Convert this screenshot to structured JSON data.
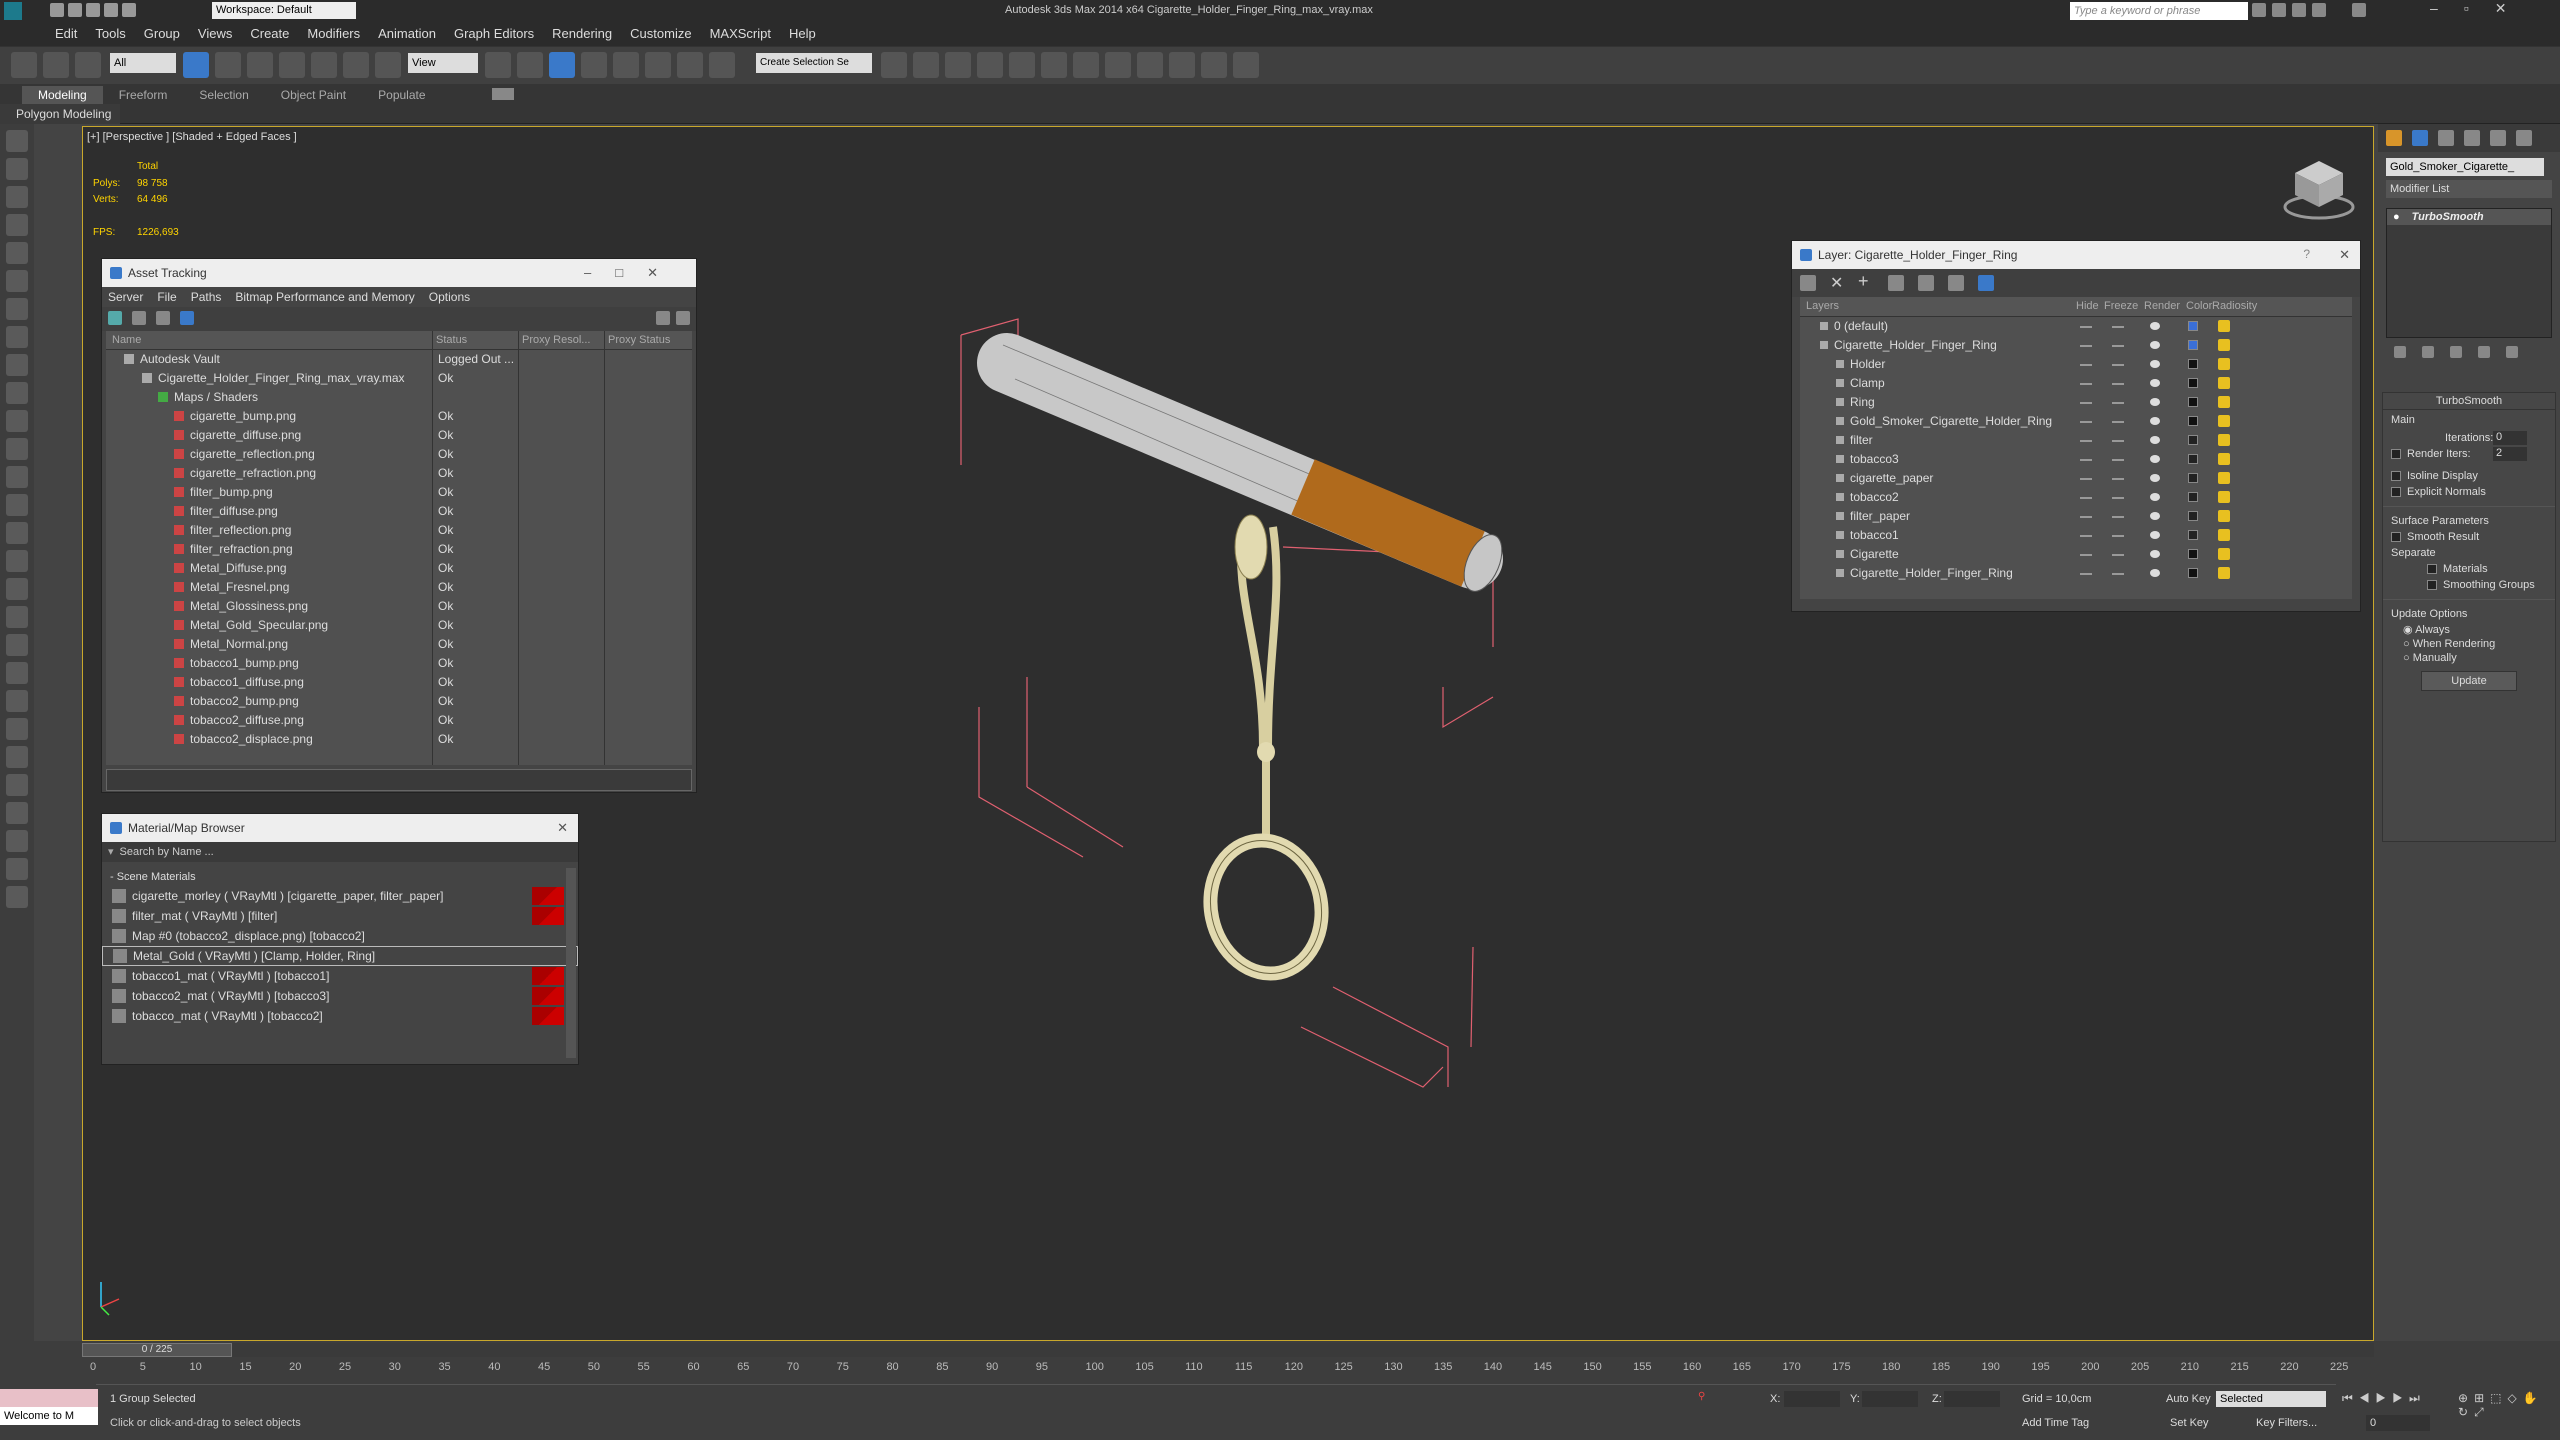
{
  "app": {
    "title": "Autodesk 3ds Max  2014 x64      Cigarette_Holder_Finger_Ring_max_vray.max",
    "workspace": "Workspace: Default",
    "search_placeholder": "Type a keyword or phrase"
  },
  "menu": [
    "Edit",
    "Tools",
    "Group",
    "Views",
    "Create",
    "Modifiers",
    "Animation",
    "Graph Editors",
    "Rendering",
    "Customize",
    "MAXScript",
    "Help"
  ],
  "toolbar": {
    "selection_filter": "All",
    "view_dropdown": "View",
    "named_selection": "Create Selection Se"
  },
  "ribbon": {
    "tabs": [
      "Modeling",
      "Freeform",
      "Selection",
      "Object Paint",
      "Populate"
    ],
    "sub": "Polygon Modeling"
  },
  "viewport": {
    "label": "[+] [Perspective ] [Shaded + Edged Faces ]",
    "stats_total": "Total",
    "polys_label": "Polys:",
    "polys": "98 758",
    "verts_label": "Verts:",
    "verts": "64 496",
    "fps_label": "FPS:",
    "fps": "1226,693"
  },
  "asset": {
    "title": "Asset Tracking",
    "menu": [
      "Server",
      "File",
      "Paths",
      "Bitmap Performance and Memory",
      "Options"
    ],
    "cols": [
      "Name",
      "Status",
      "Proxy Resol...",
      "Proxy Status"
    ],
    "rows": [
      {
        "n": "Autodesk Vault",
        "s": "Logged Out ...",
        "lvl": 1
      },
      {
        "n": "Cigarette_Holder_Finger_Ring_max_vray.max",
        "s": "Ok",
        "lvl": 2
      },
      {
        "n": "Maps / Shaders",
        "s": "",
        "lvl": 3
      },
      {
        "n": "cigarette_bump.png",
        "s": "Ok",
        "lvl": 4
      },
      {
        "n": "cigarette_diffuse.png",
        "s": "Ok",
        "lvl": 4
      },
      {
        "n": "cigarette_reflection.png",
        "s": "Ok",
        "lvl": 4
      },
      {
        "n": "cigarette_refraction.png",
        "s": "Ok",
        "lvl": 4
      },
      {
        "n": "filter_bump.png",
        "s": "Ok",
        "lvl": 4
      },
      {
        "n": "filter_diffuse.png",
        "s": "Ok",
        "lvl": 4
      },
      {
        "n": "filter_reflection.png",
        "s": "Ok",
        "lvl": 4
      },
      {
        "n": "filter_refraction.png",
        "s": "Ok",
        "lvl": 4
      },
      {
        "n": "Metal_Diffuse.png",
        "s": "Ok",
        "lvl": 4
      },
      {
        "n": "Metal_Fresnel.png",
        "s": "Ok",
        "lvl": 4
      },
      {
        "n": "Metal_Glossiness.png",
        "s": "Ok",
        "lvl": 4
      },
      {
        "n": "Metal_Gold_Specular.png",
        "s": "Ok",
        "lvl": 4
      },
      {
        "n": "Metal_Normal.png",
        "s": "Ok",
        "lvl": 4
      },
      {
        "n": "tobacco1_bump.png",
        "s": "Ok",
        "lvl": 4
      },
      {
        "n": "tobacco1_diffuse.png",
        "s": "Ok",
        "lvl": 4
      },
      {
        "n": "tobacco2_bump.png",
        "s": "Ok",
        "lvl": 4
      },
      {
        "n": "tobacco2_diffuse.png",
        "s": "Ok",
        "lvl": 4
      },
      {
        "n": "tobacco2_displace.png",
        "s": "Ok",
        "lvl": 4
      }
    ]
  },
  "matbrowser": {
    "title": "Material/Map Browser",
    "search": "Search by Name ...",
    "group": "- Scene Materials",
    "items": [
      "cigarette_morley  ( VRayMtl ) [cigarette_paper, filter_paper]",
      "filter_mat  ( VRayMtl ) [filter]",
      "Map #0 (tobacco2_displace.png) [tobacco2]",
      "Metal_Gold  ( VRayMtl ) [Clamp, Holder, Ring]",
      "tobacco1_mat  ( VRayMtl ) [tobacco1]",
      "tobacco2_mat  ( VRayMtl ) [tobacco3]",
      "tobacco_mat  ( VRayMtl ) [tobacco2]"
    ]
  },
  "layer": {
    "title": "Layer: Cigarette_Holder_Finger_Ring",
    "cols": [
      "Layers",
      "Hide",
      "Freeze",
      "Render",
      "Color",
      "Radiosity"
    ],
    "rows": [
      {
        "n": "0 (default)",
        "lvl": 1,
        "c": "#3a6fd8"
      },
      {
        "n": "Cigarette_Holder_Finger_Ring",
        "lvl": 1,
        "c": "#3a6fd8"
      },
      {
        "n": "Holder",
        "lvl": 2,
        "c": "#111"
      },
      {
        "n": "Clamp",
        "lvl": 2,
        "c": "#111"
      },
      {
        "n": "Ring",
        "lvl": 2,
        "c": "#111"
      },
      {
        "n": "Gold_Smoker_Cigarette_Holder_Ring",
        "lvl": 2,
        "c": "#111"
      },
      {
        "n": "filter",
        "lvl": 2,
        "c": "#222"
      },
      {
        "n": "tobacco3",
        "lvl": 2,
        "c": "#222"
      },
      {
        "n": "cigarette_paper",
        "lvl": 2,
        "c": "#222"
      },
      {
        "n": "tobacco2",
        "lvl": 2,
        "c": "#222"
      },
      {
        "n": "filter_paper",
        "lvl": 2,
        "c": "#222"
      },
      {
        "n": "tobacco1",
        "lvl": 2,
        "c": "#222"
      },
      {
        "n": "Cigarette",
        "lvl": 2,
        "c": "#111"
      },
      {
        "n": "Cigarette_Holder_Finger_Ring",
        "lvl": 2,
        "c": "#111"
      }
    ]
  },
  "cmd": {
    "object_name": "Gold_Smoker_Cigarette_",
    "modifier_list": "Modifier List",
    "modifier": "TurboSmooth",
    "rollout": "TurboSmooth",
    "main": "Main",
    "iterations_label": "Iterations:",
    "iterations": "0",
    "render_iters_label": "Render Iters:",
    "render_iters": "2",
    "isoline": "Isoline Display",
    "explicit": "Explicit Normals",
    "surface": "Surface Parameters",
    "smooth_result": "Smooth Result",
    "separate": "Separate",
    "materials": "Materials",
    "smoothing_groups": "Smoothing Groups",
    "update_options": "Update Options",
    "always": "Always",
    "when_rendering": "When Rendering",
    "manually": "Manually",
    "update_btn": "Update"
  },
  "timeline": {
    "frame": "0 / 225",
    "ticks": [
      "0",
      "5",
      "10",
      "15",
      "20",
      "25",
      "30",
      "35",
      "40",
      "45",
      "50",
      "55",
      "60",
      "65",
      "70",
      "75",
      "80",
      "85",
      "90",
      "95",
      "100",
      "105",
      "110",
      "115",
      "120",
      "125",
      "130",
      "135",
      "140",
      "145",
      "150",
      "155",
      "160",
      "165",
      "170",
      "175",
      "180",
      "185",
      "190",
      "195",
      "200",
      "205",
      "210",
      "215",
      "220",
      "225"
    ]
  },
  "status": {
    "welcome": "Welcome to M",
    "selected": "1 Group Selected",
    "prompt": "Click or click-and-drag to select objects",
    "x": "X:",
    "y": "Y:",
    "z": "Z:",
    "grid": "Grid = 10,0cm",
    "add_time_tag": "Add Time Tag",
    "auto_key": "Auto Key",
    "selected_dd": "Selected",
    "set_key": "Set Key",
    "key_filters": "Key Filters...",
    "frame_val": "0"
  }
}
